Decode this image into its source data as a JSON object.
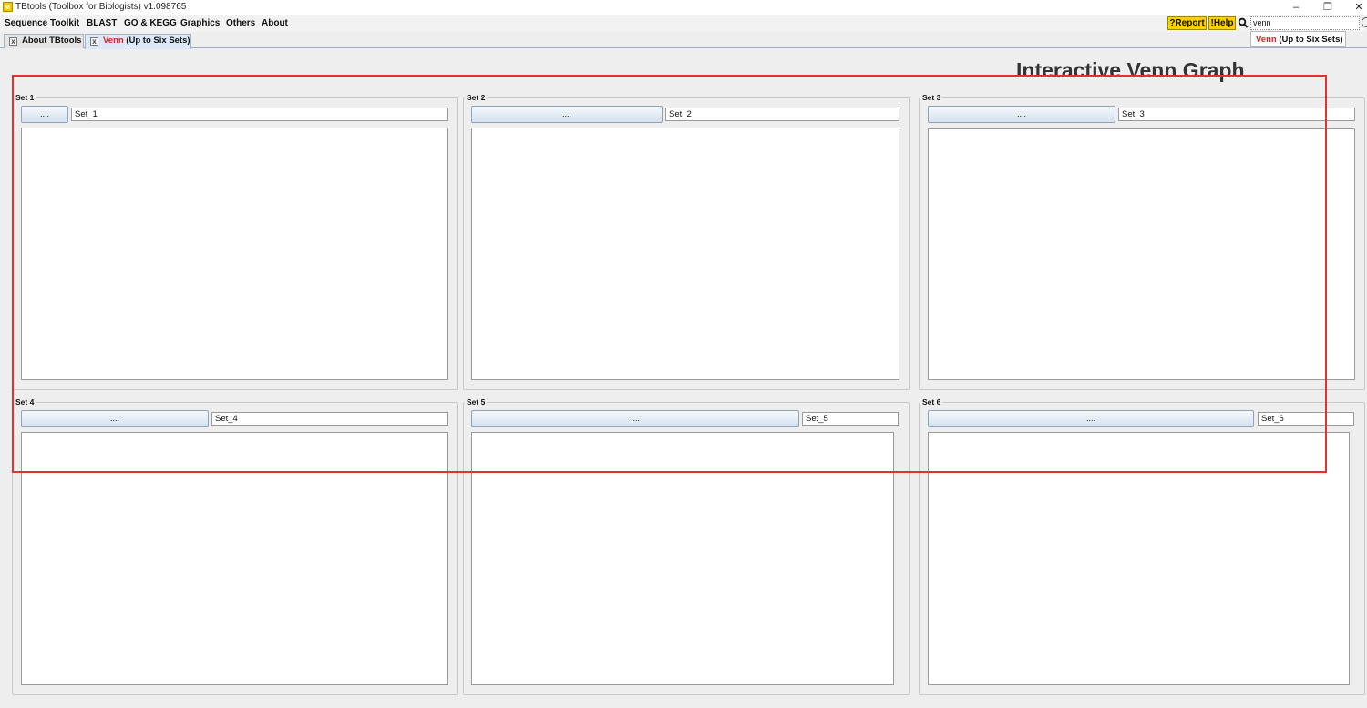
{
  "window": {
    "title": "TBtools (Toolbox for Biologists) v1.098765",
    "minimize": "–",
    "restore": "❐",
    "close": "✕"
  },
  "menu": {
    "items": [
      "Sequence Toolkit",
      "BLAST",
      "GO & KEGG",
      "Graphics",
      "Others",
      "About"
    ],
    "report_label": "?Report",
    "help_label": "!Help",
    "search_value": "venn"
  },
  "tabs": [
    {
      "label": "About TBtools",
      "close": "x"
    },
    {
      "label_prefix": "Venn",
      "label_suffix": " (Up to Six Sets)",
      "close": "x"
    }
  ],
  "search_suggestion": {
    "prefix": "Venn",
    "suffix": " (Up to Six Sets)"
  },
  "main": {
    "graph_title": "Interactive Venn Graph",
    "sets": [
      {
        "legend": "Set 1",
        "button_label": "....",
        "name_value": "Set_1"
      },
      {
        "legend": "Set 2",
        "button_label": "....",
        "name_value": "Set_2"
      },
      {
        "legend": "Set 3",
        "button_label": "....",
        "name_value": "Set_3"
      },
      {
        "legend": "Set 4",
        "button_label": "....",
        "name_value": "Set_4"
      },
      {
        "legend": "Set 5",
        "button_label": "....",
        "name_value": "Set_5"
      },
      {
        "legend": "Set 6",
        "button_label": "....",
        "name_value": "Set_6"
      }
    ]
  },
  "colors": {
    "highlight": "#e53030",
    "accent_yellow": "#ffd000",
    "tab_red": "#e02020"
  }
}
